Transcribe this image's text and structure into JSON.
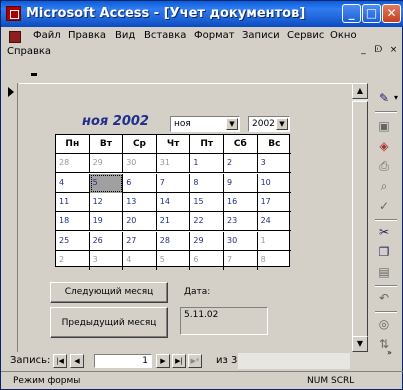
{
  "window": {
    "title": "Microsoft Access - [Учет документов]",
    "min_label": "_",
    "max_label": "□",
    "close_label": "✕"
  },
  "menu": {
    "items": [
      "Файл",
      "Правка",
      "Вид",
      "Вставка",
      "Формат",
      "Записи",
      "Сервис",
      "Окно"
    ],
    "help": "Справка",
    "mdi_min": "_",
    "mdi_restore": "ᗟ",
    "mdi_close": "×"
  },
  "calendar": {
    "header_title": "ноя 2002",
    "month_select": "ноя",
    "year_select": "2002",
    "weekdays": [
      "Пн",
      "Вт",
      "Ср",
      "Чт",
      "Пт",
      "Сб",
      "Вс"
    ],
    "weeks": [
      [
        {
          "d": "28",
          "dim": true
        },
        {
          "d": "29",
          "dim": true
        },
        {
          "d": "30",
          "dim": true
        },
        {
          "d": "31",
          "dim": true
        },
        {
          "d": "1"
        },
        {
          "d": "2"
        },
        {
          "d": "3"
        }
      ],
      [
        {
          "d": "4"
        },
        {
          "d": "5",
          "sel": true
        },
        {
          "d": "6"
        },
        {
          "d": "7"
        },
        {
          "d": "8"
        },
        {
          "d": "9"
        },
        {
          "d": "10"
        }
      ],
      [
        {
          "d": "11"
        },
        {
          "d": "12"
        },
        {
          "d": "13"
        },
        {
          "d": "14"
        },
        {
          "d": "15"
        },
        {
          "d": "16"
        },
        {
          "d": "17"
        }
      ],
      [
        {
          "d": "18"
        },
        {
          "d": "19"
        },
        {
          "d": "20"
        },
        {
          "d": "21"
        },
        {
          "d": "22"
        },
        {
          "d": "23"
        },
        {
          "d": "24"
        }
      ],
      [
        {
          "d": "25"
        },
        {
          "d": "26"
        },
        {
          "d": "27"
        },
        {
          "d": "28"
        },
        {
          "d": "29"
        },
        {
          "d": "30"
        },
        {
          "d": "1",
          "dim": true
        }
      ],
      [
        {
          "d": "2",
          "dim": true
        },
        {
          "d": "3",
          "dim": true
        },
        {
          "d": "4",
          "dim": true
        },
        {
          "d": "5",
          "dim": true
        },
        {
          "d": "6",
          "dim": true
        },
        {
          "d": "7",
          "dim": true
        },
        {
          "d": "8",
          "dim": true
        }
      ]
    ]
  },
  "form": {
    "next_month_label": "Следующий месяц",
    "prev_month_label": "Предыдущий месяц",
    "date_label": "Дата:",
    "date_value": "5.11.02"
  },
  "navbar": {
    "label": "Запись:",
    "current": "1",
    "of_label": "из  3"
  },
  "status": {
    "mode": "Режим формы",
    "num": "NUM",
    "scrl": "SCRL"
  },
  "colors": {
    "title_blue": "#0a5bd8",
    "calendar_blue": "#1f2f8a"
  }
}
